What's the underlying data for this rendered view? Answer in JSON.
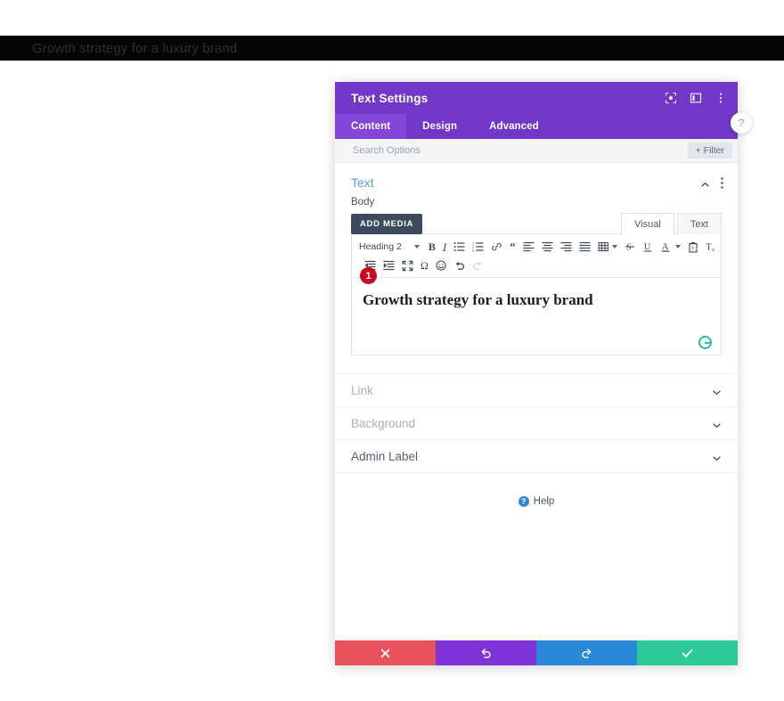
{
  "page": {
    "banner_title": "Growth strategy for a luxury brand"
  },
  "modal": {
    "title": "Text Settings",
    "header_icons": [
      {
        "name": "focus-icon"
      },
      {
        "name": "panel-layout-icon"
      },
      {
        "name": "more-vertical-icon"
      }
    ],
    "tabs": [
      {
        "label": "Content",
        "active": true
      },
      {
        "label": "Design",
        "active": false
      },
      {
        "label": "Advanced",
        "active": false
      }
    ],
    "search": {
      "placeholder": "Search Options",
      "value": ""
    },
    "filter_button": "+ Filter",
    "side_circle": "?"
  },
  "text_section": {
    "heading": "Text",
    "field_label": "Body",
    "add_media_label": "ADD MEDIA",
    "editor_tabs": [
      {
        "label": "Visual",
        "active": true
      },
      {
        "label": "Text",
        "active": false
      }
    ],
    "toolbar": {
      "format_select": "Heading 2",
      "row1": [
        {
          "name": "bold-icon",
          "glyph": "B"
        },
        {
          "name": "italic-icon",
          "glyph": "I"
        },
        {
          "name": "bulleted-list-icon",
          "glyph": ""
        },
        {
          "name": "numbered-list-icon",
          "glyph": ""
        },
        {
          "name": "link-icon",
          "glyph": ""
        },
        {
          "name": "blockquote-icon",
          "glyph": "“"
        },
        {
          "name": "align-left-icon",
          "glyph": ""
        },
        {
          "name": "align-center-icon",
          "glyph": ""
        },
        {
          "name": "align-right-icon",
          "glyph": ""
        },
        {
          "name": "align-justify-icon",
          "glyph": ""
        },
        {
          "name": "table-icon",
          "glyph": ""
        },
        {
          "name": "strikethrough-icon",
          "glyph": "S"
        },
        {
          "name": "underline-icon",
          "glyph": "U"
        },
        {
          "name": "text-color-icon",
          "glyph": "A"
        },
        {
          "name": "paste-as-text-icon",
          "glyph": ""
        },
        {
          "name": "clear-formatting-icon",
          "glyph": ""
        }
      ],
      "row2": [
        {
          "name": "outdent-icon"
        },
        {
          "name": "indent-icon"
        },
        {
          "name": "fullscreen-icon"
        },
        {
          "name": "special-character-icon",
          "glyph": "Ω"
        },
        {
          "name": "emoji-icon"
        },
        {
          "name": "undo-icon"
        },
        {
          "name": "redo-icon"
        }
      ]
    },
    "content": {
      "body_text": "Growth strategy for a luxury brand",
      "badge_number": "1",
      "grammar_assistant": "grammarly-icon"
    }
  },
  "accordions": [
    {
      "label": "Link",
      "state": "collapsed",
      "tone": "muted"
    },
    {
      "label": "Background",
      "state": "collapsed",
      "tone": "muted"
    },
    {
      "label": "Admin Label",
      "state": "collapsed",
      "tone": "dark"
    }
  ],
  "help": {
    "icon": "question-mark-icon",
    "label": "Help"
  },
  "footer": {
    "buttons": [
      {
        "name": "cancel-button",
        "icon": "close-icon",
        "color": "#e8505b"
      },
      {
        "name": "undo-button",
        "icon": "undo-arrow-icon",
        "color": "#7d33d6"
      },
      {
        "name": "redo-button",
        "icon": "redo-arrow-icon",
        "color": "#2b88d8"
      },
      {
        "name": "save-button",
        "icon": "check-icon",
        "color": "#2cc999"
      }
    ]
  },
  "colors": {
    "modal_header_purple": "#7137c8",
    "tab_active_purple": "#8247d8",
    "section_heading_blue": "#5b9dd9",
    "badge_red": "#cc0a1e",
    "grammarly_green": "#1fc4a0"
  }
}
